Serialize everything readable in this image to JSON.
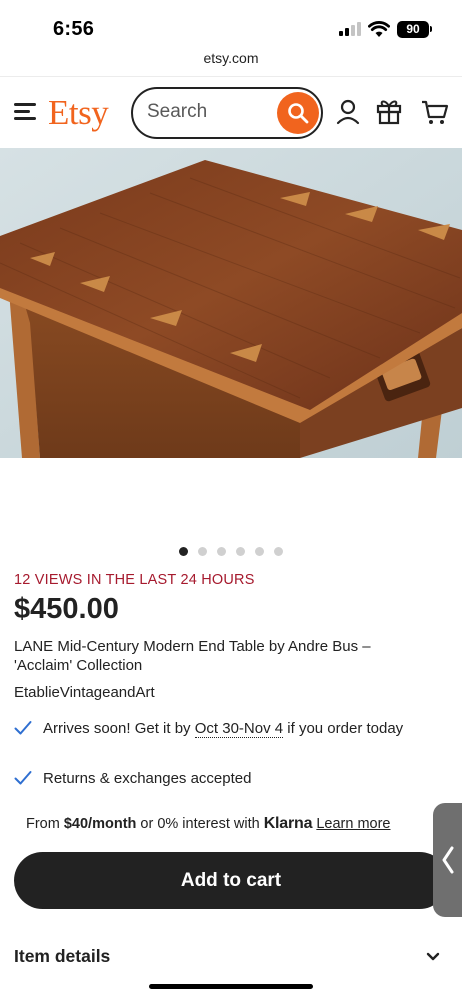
{
  "status_bar": {
    "time": "6:56",
    "battery": "90"
  },
  "browser": {
    "url": "etsy.com"
  },
  "header": {
    "logo": "Etsy",
    "search_placeholder": "Search"
  },
  "carousel": {
    "total": 6,
    "active": 1
  },
  "product": {
    "views": "12 VIEWS IN THE LAST 24 HOURS",
    "price": "$450.00",
    "title": "LANE Mid-Century Modern End Table by Andre Bus – 'Acclaim' Collection",
    "shop": "EtablieVintageandArt"
  },
  "shipping": {
    "arrives_prefix": "Arrives soon! Get it by ",
    "arrives_dates": "Oct 30-Nov 4",
    "arrives_suffix": " if you order today",
    "returns": "Returns & exchanges accepted"
  },
  "financing": {
    "from": "From ",
    "amount": "$40/month",
    "or": " or 0% interest with ",
    "provider": "Klarna",
    "learn_more": "Learn more"
  },
  "actions": {
    "add_to_cart": "Add to cart"
  },
  "sections": {
    "item_details": "Item details"
  },
  "colors": {
    "brand": "#f1641e",
    "views": "#a61a2e",
    "check": "#2f6fd1",
    "dark": "#222222"
  }
}
